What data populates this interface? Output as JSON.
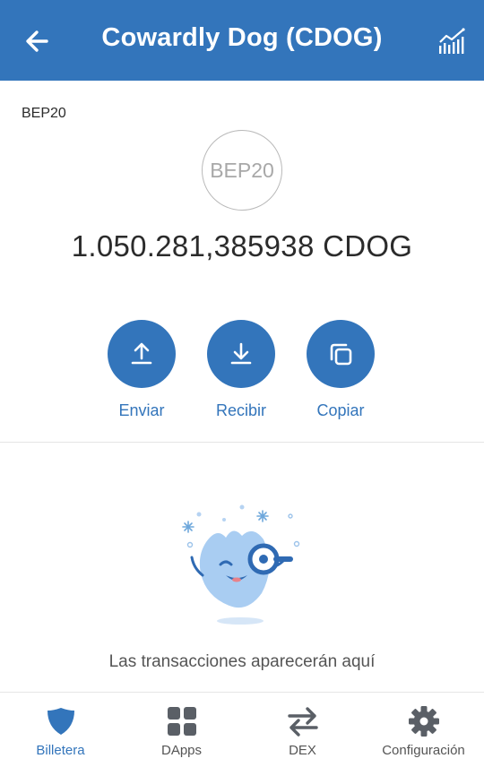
{
  "header": {
    "title": "Cowardly Dog (CDOG)",
    "back_icon": "arrow-left-icon",
    "chart_icon": "chart-icon",
    "bg_color": "#3375bb"
  },
  "token": {
    "network": "BEP20",
    "logo_text": "BEP20",
    "balance": "1.050.281,385938 CDOG"
  },
  "actions": [
    {
      "label": "Enviar",
      "icon": "upload-icon"
    },
    {
      "label": "Recibir",
      "icon": "download-icon"
    },
    {
      "label": "Copiar",
      "icon": "copy-icon"
    }
  ],
  "empty_state": {
    "text": "Las transacciones aparecerán aquí",
    "icon": "search-mascot-illustration"
  },
  "bottom_nav": [
    {
      "label": "Billetera",
      "icon": "shield-icon",
      "active": true
    },
    {
      "label": "DApps",
      "icon": "grid-icon",
      "active": false
    },
    {
      "label": "DEX",
      "icon": "swap-icon",
      "active": false
    },
    {
      "label": "Configuración",
      "icon": "gear-icon",
      "active": false
    }
  ],
  "colors": {
    "accent": "#3375bb",
    "inactive": "#555555"
  }
}
